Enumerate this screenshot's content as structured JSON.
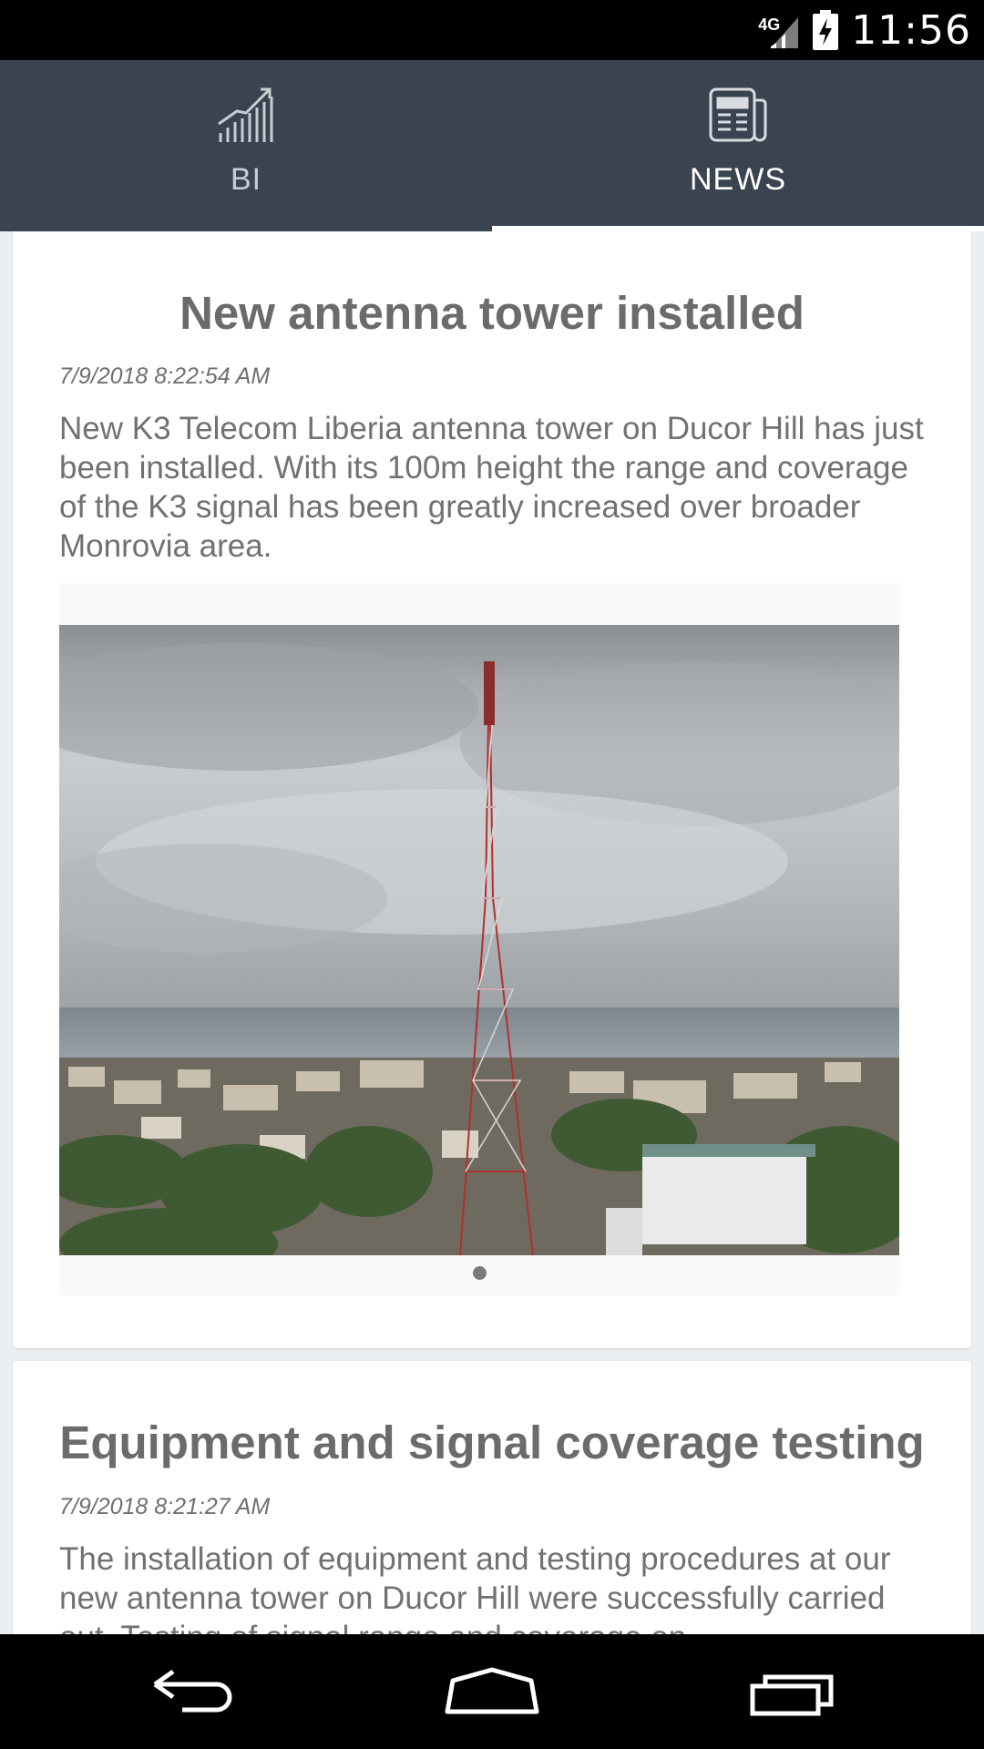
{
  "status_bar": {
    "network": "4G",
    "time": "11:56"
  },
  "tabs": [
    {
      "label": "BI",
      "icon": "bar-chart-icon",
      "active": false
    },
    {
      "label": "NEWS",
      "icon": "newspaper-icon",
      "active": true
    }
  ],
  "news": [
    {
      "title": "New antenna tower installed",
      "date": "7/9/2018 8:22:54 AM",
      "body": "New K3 Telecom Liberia antenna tower on Ducor Hill has just been installed. With its 100m height the range and coverage of the K3 signal has been greatly increased over broader Monrovia area."
    },
    {
      "title": "Equipment and signal coverage testing",
      "date": "7/9/2018 8:21:27 AM",
      "body": "The installation of equipment and testing procedures at our new antenna tower on Ducor Hill were successfully carried out. Testing of signal range and coverage on"
    }
  ],
  "nav": {
    "back_icon": "back-arrow-icon",
    "home_icon": "home-icon",
    "recents_icon": "recent-apps-icon"
  },
  "colors": {
    "tab_bar": "#3a4350",
    "title_text": "#6b6b6b",
    "body_text": "#717171"
  }
}
